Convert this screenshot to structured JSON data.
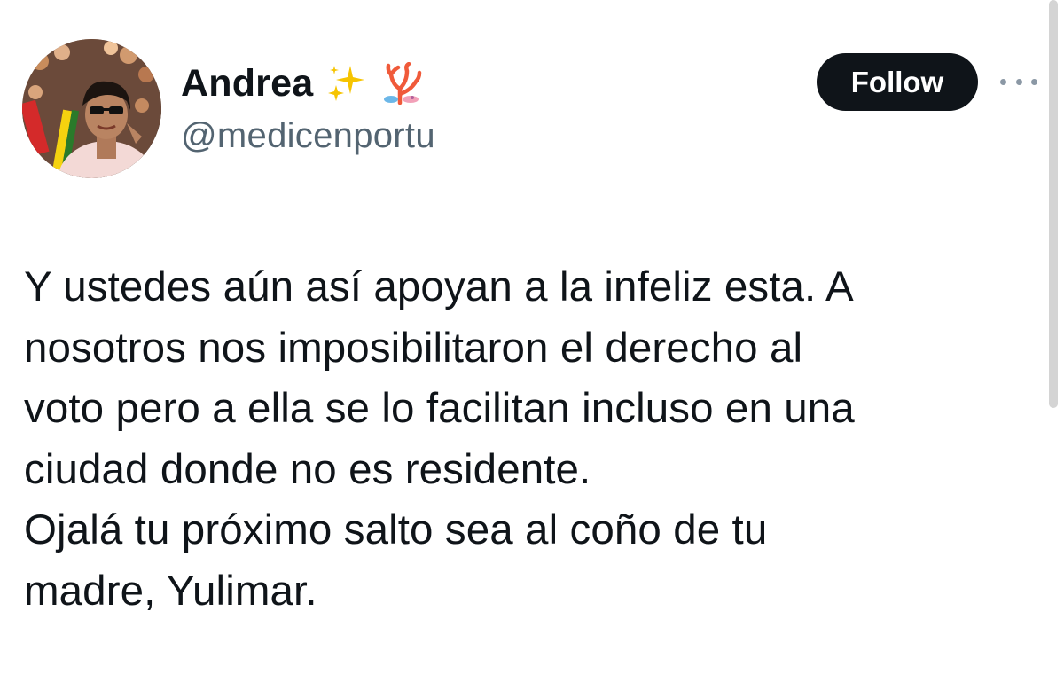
{
  "author": {
    "display_name": "Andrea",
    "handle": "@medicenportu",
    "name_emojis": [
      "sparkles-icon",
      "coral-icon"
    ]
  },
  "actions": {
    "follow_label": "Follow",
    "more_icon": "more-horizontal-icon"
  },
  "tweet": {
    "lines": [
      "Y ustedes aún así apoyan a la infeliz esta. A",
      "nosotros nos imposibilitaron el derecho al",
      "voto pero a ella se lo facilitan incluso en una",
      "ciudad donde no es residente.",
      "Ojalá tu próximo salto sea al coño de tu",
      "madre, Yulimar."
    ]
  },
  "colors": {
    "text_primary": "#0f1419",
    "text_secondary": "#536471",
    "follow_bg": "#0f1419",
    "follow_text": "#ffffff",
    "background": "#ffffff"
  }
}
